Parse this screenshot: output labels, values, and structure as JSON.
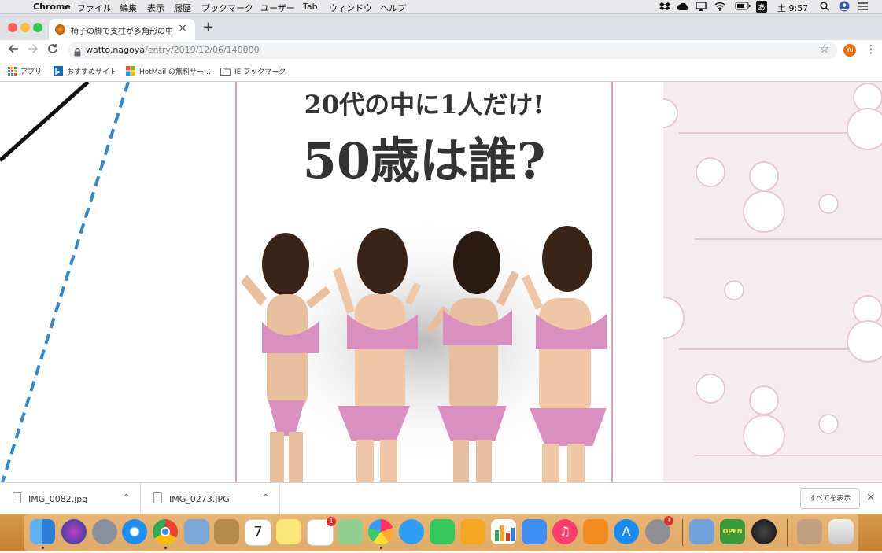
{
  "menubar": {
    "app_name": "Chrome",
    "menus": [
      "ファイル",
      "編集",
      "表示",
      "履歴",
      "ブックマーク",
      "ユーザー",
      "Tab",
      "ウィンドウ",
      "ヘルプ"
    ],
    "ime_label": "あ",
    "clock": "土 9:57"
  },
  "tab": {
    "title": "椅子の脚で支柱が多角形の中心か…",
    "close_label": "×",
    "new_tab_label": "+"
  },
  "toolbar": {
    "url_host": "watto.nagoya",
    "url_path": "/entry/2019/12/06/140000",
    "profile_initials": "Yu"
  },
  "bookmarks": {
    "items": [
      {
        "label": "アプリ",
        "icon": "apps-grid-icon"
      },
      {
        "label": "おすすめサイト",
        "icon": "bing-icon"
      },
      {
        "label": "HotMail の無料サー…",
        "icon": "microsoft-icon"
      },
      {
        "label": "IE ブックマーク",
        "icon": "folder-icon"
      }
    ]
  },
  "content": {
    "headline_line1": "20代の中に1人だけ!",
    "headline_line2": "50歳は誰?"
  },
  "downloads": {
    "items": [
      {
        "filename": "IMG_0082.jpg"
      },
      {
        "filename": "IMG_0273.JPG"
      }
    ],
    "show_all_label": "すべてを表示",
    "close_label": "×"
  },
  "dock": {
    "reminders_badge": "1",
    "prefs_badge": "1",
    "calendar_day": "7",
    "open_sign": "OPEN"
  },
  "colors": {
    "article_border": "#e89ab0",
    "diagonal_dashed": "#2f88d0",
    "sidebar_bg": "#f6ecef",
    "bikini": "#d98fc0"
  }
}
